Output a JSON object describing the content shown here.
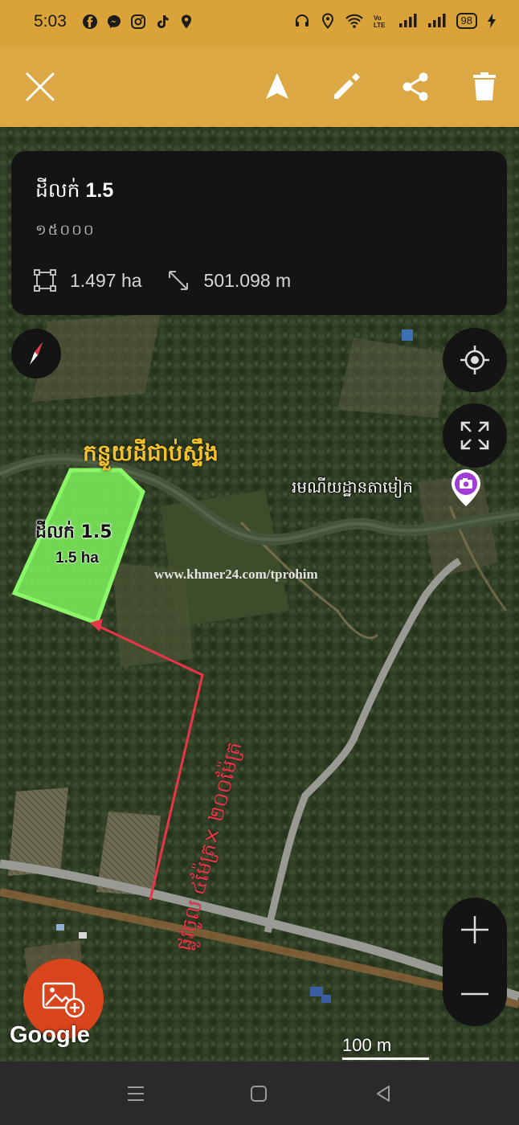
{
  "status_bar": {
    "time": "5:03",
    "battery": "98",
    "left_icons": [
      "facebook-icon",
      "messenger-icon",
      "instagram-icon",
      "tiktok-icon",
      "location-icon"
    ],
    "right_icons": [
      "headset-icon",
      "location-icon",
      "wifi-icon",
      "volte-icon",
      "signal-icon",
      "signal-icon",
      "battery-icon",
      "charging-icon"
    ]
  },
  "toolbar": {
    "background": "#dba844",
    "buttons": [
      "close-icon",
      "navigate-icon",
      "edit-icon",
      "share-icon",
      "delete-icon"
    ]
  },
  "info_card": {
    "title_prefix": "ដីលក់",
    "title_value": "1.5",
    "subtitle": "១៥០០០",
    "area": "1.497 ha",
    "perimeter": "501.098 m"
  },
  "map": {
    "plot_label_title": "ដីលក់ 1.5",
    "plot_label_area": "1.5 ha",
    "place_label": "កន្លួយដីជាប់ស្ទឹង",
    "poi_label": "រមណីយដ្ឋានតាមៀក",
    "watermark": "www.khmer24.com/tprohim",
    "route_label": "ផ្លូវចូល ៤ម៉ែត្រ× ២០០ម៉ែត្រ",
    "plot_color": "#7cf25c",
    "route_color": "#e8354a",
    "label_color": "#f2c12e",
    "google_logo": "Google",
    "scale": "100 m"
  },
  "navbar": {
    "buttons": [
      "menu-icon",
      "home-icon",
      "back-icon"
    ]
  }
}
